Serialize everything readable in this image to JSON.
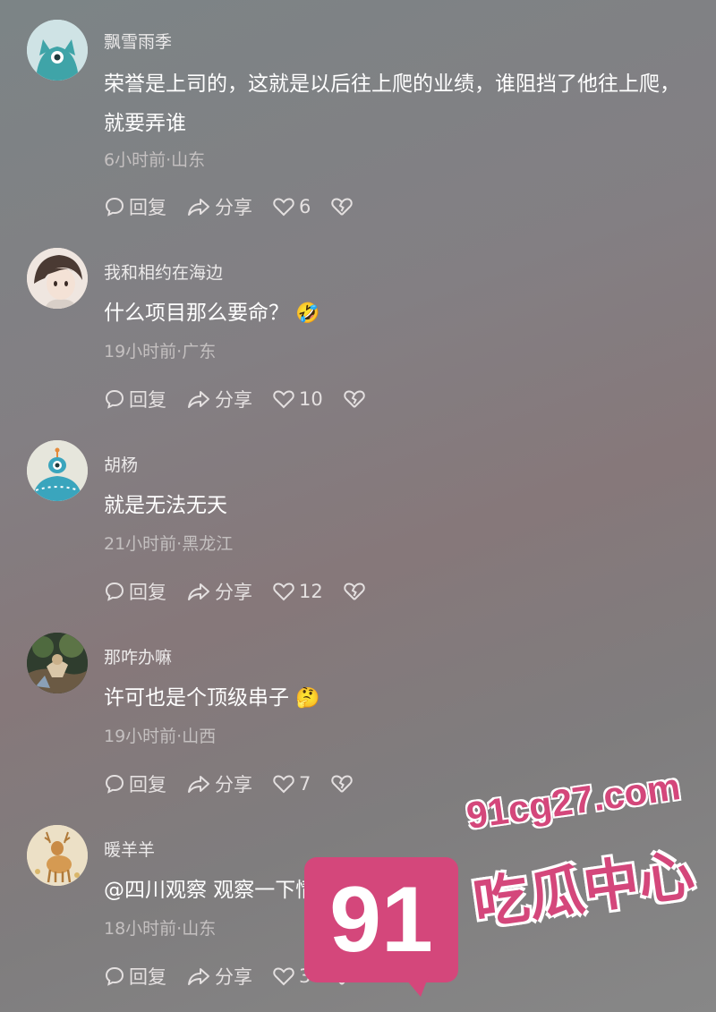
{
  "comments": [
    {
      "username": "飘雪雨季",
      "text": "荣誉是上司的，这就是以后往上爬的业绩，谁阻挡了他往上爬，就要弄谁",
      "meta": "6小时前·山东",
      "reply_label": "回复",
      "share_label": "分享",
      "likes": "6",
      "avatar_icon": "blue-monster-avatar"
    },
    {
      "username": "我和相约在海边",
      "text": "什么项目那么要命？",
      "emoji": "🤣",
      "meta": "19小时前·广东",
      "reply_label": "回复",
      "share_label": "分享",
      "likes": "10",
      "avatar_icon": "anime-boy-avatar"
    },
    {
      "username": "胡杨",
      "text": "就是无法无天",
      "meta": "21小时前·黑龙江",
      "reply_label": "回复",
      "share_label": "分享",
      "likes": "12",
      "avatar_icon": "blue-monster-avatar"
    },
    {
      "username": "那咋办嘛",
      "text": "许可也是个顶级串子",
      "emoji": "🤔",
      "meta": "19小时前·山西",
      "reply_label": "回复",
      "share_label": "分享",
      "likes": "7",
      "avatar_icon": "photo-avatar"
    },
    {
      "username": "暖羊羊",
      "text": "@四川观察  观察一下情况",
      "meta": "18小时前·山东",
      "reply_label": "回复",
      "share_label": "分享",
      "likes": "3",
      "avatar_icon": "deer-avatar"
    }
  ],
  "watermark": {
    "number": "91",
    "url": "91cg27.com",
    "text": "吃瓜中心"
  },
  "colors": {
    "watermark_pink": "#d4477b",
    "avatar_teal": "#3fa4a8",
    "avatar_bg": "#c9e0e2"
  }
}
